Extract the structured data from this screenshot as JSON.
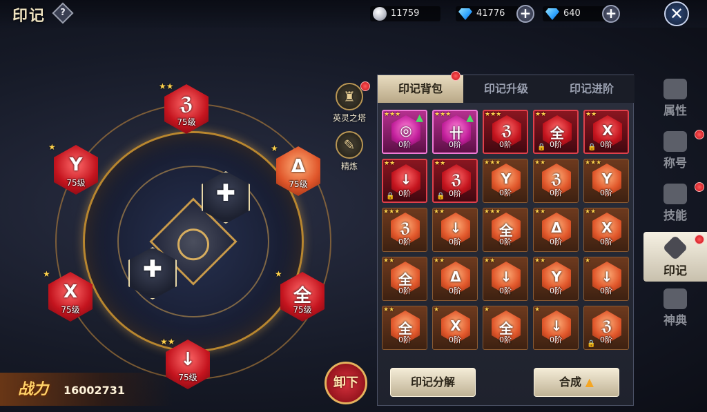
{
  "header": {
    "title": "印记",
    "help_icon": "question-icon",
    "silver_coins": "11759",
    "diamonds": "41776",
    "bound_diamonds": "640",
    "close_icon": "close-icon"
  },
  "equipped": {
    "slots": [
      {
        "id": "top",
        "rune": "ℨ",
        "level": "75级",
        "stars": "★★",
        "color": "red"
      },
      {
        "id": "upper-left",
        "rune": "Y",
        "level": "75级",
        "stars": "★",
        "color": "red"
      },
      {
        "id": "upper-right",
        "rune": "Δ",
        "level": "75级",
        "stars": "★",
        "color": "orange"
      },
      {
        "id": "lower-left",
        "rune": "X",
        "level": "75级",
        "stars": "★",
        "color": "red"
      },
      {
        "id": "lower-right",
        "rune": "全",
        "level": "75级",
        "stars": "★",
        "color": "red"
      },
      {
        "id": "bottom",
        "rune": "↓",
        "level": "75级",
        "stars": "★★",
        "color": "red"
      },
      {
        "id": "inner-upper",
        "rune": "✚",
        "level": "",
        "stars": "",
        "color": "dark"
      },
      {
        "id": "inner-lower",
        "rune": "✚",
        "level": "",
        "stars": "",
        "color": "dark"
      }
    ]
  },
  "side_buttons": {
    "tower_label": "英灵之塔",
    "refine_label": "精炼"
  },
  "power": {
    "label": "战力",
    "value": "16002731"
  },
  "unload_label": "卸下",
  "panel": {
    "tabs": [
      "印记背包",
      "印记升级",
      "印记进阶"
    ],
    "active_tab": 0,
    "decompose_label": "印记分解",
    "synthesize_label": "合成",
    "items": [
      {
        "rune": "◎",
        "tier": "0阶",
        "style": "pink",
        "stars": 3,
        "locked": false,
        "upgrade": true
      },
      {
        "rune": "卄",
        "tier": "0阶",
        "style": "pink",
        "stars": 3,
        "locked": false,
        "upgrade": true
      },
      {
        "rune": "ℨ",
        "tier": "0阶",
        "style": "red",
        "stars": 3,
        "locked": false,
        "upgrade": false
      },
      {
        "rune": "全",
        "tier": "0阶",
        "style": "red",
        "stars": 2,
        "locked": true,
        "upgrade": false
      },
      {
        "rune": "X",
        "tier": "0阶",
        "style": "red",
        "stars": 2,
        "locked": true,
        "upgrade": false
      },
      {
        "rune": "↓",
        "tier": "0阶",
        "style": "red",
        "stars": 2,
        "locked": true,
        "upgrade": false
      },
      {
        "rune": "ℨ",
        "tier": "0阶",
        "style": "red",
        "stars": 2,
        "locked": true,
        "upgrade": false
      },
      {
        "rune": "Y",
        "tier": "0阶",
        "style": "orange",
        "stars": 3,
        "locked": false,
        "upgrade": false
      },
      {
        "rune": "ℨ",
        "tier": "0阶",
        "style": "orange",
        "stars": 2,
        "locked": false,
        "upgrade": false
      },
      {
        "rune": "Y",
        "tier": "0阶",
        "style": "orange",
        "stars": 3,
        "locked": false,
        "upgrade": false
      },
      {
        "rune": "ℨ",
        "tier": "0阶",
        "style": "orange",
        "stars": 3,
        "locked": false,
        "upgrade": false
      },
      {
        "rune": "↓",
        "tier": "0阶",
        "style": "orange",
        "stars": 2,
        "locked": false,
        "upgrade": false
      },
      {
        "rune": "全",
        "tier": "0阶",
        "style": "orange",
        "stars": 3,
        "locked": false,
        "upgrade": false
      },
      {
        "rune": "Δ",
        "tier": "0阶",
        "style": "orange",
        "stars": 2,
        "locked": false,
        "upgrade": false
      },
      {
        "rune": "X",
        "tier": "0阶",
        "style": "orange",
        "stars": 2,
        "locked": false,
        "upgrade": false
      },
      {
        "rune": "全",
        "tier": "0阶",
        "style": "orange",
        "stars": 2,
        "locked": false,
        "upgrade": false
      },
      {
        "rune": "Δ",
        "tier": "0阶",
        "style": "orange",
        "stars": 2,
        "locked": false,
        "upgrade": false
      },
      {
        "rune": "↓",
        "tier": "0阶",
        "style": "orange",
        "stars": 2,
        "locked": false,
        "upgrade": false
      },
      {
        "rune": "Y",
        "tier": "0阶",
        "style": "orange",
        "stars": 2,
        "locked": false,
        "upgrade": false
      },
      {
        "rune": "↓",
        "tier": "0阶",
        "style": "orange",
        "stars": 1,
        "locked": false,
        "upgrade": false
      },
      {
        "rune": "全",
        "tier": "0阶",
        "style": "orange",
        "stars": 2,
        "locked": false,
        "upgrade": false
      },
      {
        "rune": "X",
        "tier": "0阶",
        "style": "orange",
        "stars": 1,
        "locked": false,
        "upgrade": false
      },
      {
        "rune": "全",
        "tier": "0阶",
        "style": "orange",
        "stars": 1,
        "locked": false,
        "upgrade": false
      },
      {
        "rune": "↓",
        "tier": "0阶",
        "style": "orange",
        "stars": 1,
        "locked": false,
        "upgrade": false
      },
      {
        "rune": "ℨ",
        "tier": "0阶",
        "style": "orange",
        "stars": 0,
        "locked": true,
        "upgrade": false
      }
    ]
  },
  "right_nav": {
    "items": [
      {
        "label": "属性",
        "icon": "attribute-icon",
        "badge": false
      },
      {
        "label": "称号",
        "icon": "chest-icon",
        "badge": true
      },
      {
        "label": "技能",
        "icon": "skill-icon",
        "badge": true
      },
      {
        "label": "印记",
        "icon": "rune-icon",
        "badge": true
      },
      {
        "label": "神典",
        "icon": "book-icon",
        "badge": false
      }
    ],
    "active": 3
  }
}
